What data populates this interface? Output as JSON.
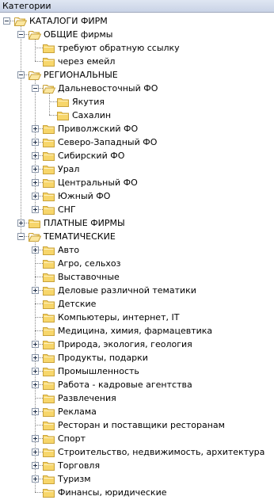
{
  "panel": {
    "title": "Категории"
  },
  "colors": {
    "folder_fill": "#f7d66b",
    "folder_edge": "#c9a23a",
    "header_bg": "#d4dcec"
  },
  "tree": [
    {
      "label": "КАТАЛОГИ ФИРМ",
      "depth": 0,
      "state": "expanded",
      "icon": "folder-open-icon"
    },
    {
      "label": "ОБЩИЕ фирмы",
      "depth": 1,
      "state": "expanded",
      "icon": "folder-open-icon"
    },
    {
      "label": "требуют обратную ссылку",
      "depth": 2,
      "state": "leaf",
      "icon": "folder-icon"
    },
    {
      "label": "через емейл",
      "depth": 2,
      "state": "leaf",
      "icon": "folder-icon"
    },
    {
      "label": "РЕГИОНАЛЬНЫЕ",
      "depth": 1,
      "state": "expanded",
      "icon": "folder-open-icon"
    },
    {
      "label": "Дальневосточный ФО",
      "depth": 2,
      "state": "expanded",
      "icon": "folder-open-icon"
    },
    {
      "label": "Якутия",
      "depth": 3,
      "state": "leaf",
      "icon": "folder-icon"
    },
    {
      "label": "Сахалин",
      "depth": 3,
      "state": "leaf",
      "icon": "folder-icon"
    },
    {
      "label": "Приволжский ФО",
      "depth": 2,
      "state": "collapsed",
      "icon": "folder-icon"
    },
    {
      "label": "Северо-Западный ФО",
      "depth": 2,
      "state": "collapsed",
      "icon": "folder-icon"
    },
    {
      "label": "Сибирский ФО",
      "depth": 2,
      "state": "collapsed",
      "icon": "folder-icon"
    },
    {
      "label": "Урал",
      "depth": 2,
      "state": "collapsed",
      "icon": "folder-icon"
    },
    {
      "label": "Центральный ФО",
      "depth": 2,
      "state": "collapsed",
      "icon": "folder-icon"
    },
    {
      "label": "Южный ФО",
      "depth": 2,
      "state": "collapsed",
      "icon": "folder-icon"
    },
    {
      "label": "СНГ",
      "depth": 2,
      "state": "collapsed",
      "icon": "folder-icon"
    },
    {
      "label": "ПЛАТНЫЕ ФИРМЫ",
      "depth": 1,
      "state": "collapsed",
      "icon": "folder-icon"
    },
    {
      "label": "ТЕМАТИЧЕСКИЕ",
      "depth": 1,
      "state": "expanded",
      "icon": "folder-open-icon"
    },
    {
      "label": "Авто",
      "depth": 2,
      "state": "collapsed",
      "icon": "folder-icon"
    },
    {
      "label": "Агро, сельхоз",
      "depth": 2,
      "state": "leaf",
      "icon": "folder-icon"
    },
    {
      "label": "Выставочные",
      "depth": 2,
      "state": "leaf",
      "icon": "folder-icon"
    },
    {
      "label": "Деловые различной тематики",
      "depth": 2,
      "state": "collapsed",
      "icon": "folder-icon"
    },
    {
      "label": "Детские",
      "depth": 2,
      "state": "leaf",
      "icon": "folder-icon"
    },
    {
      "label": "Компьютеры, интернет, IT",
      "depth": 2,
      "state": "leaf",
      "icon": "folder-icon"
    },
    {
      "label": "Медицина, химия, фармацевтика",
      "depth": 2,
      "state": "leaf",
      "icon": "folder-icon"
    },
    {
      "label": "Природа, экология, геология",
      "depth": 2,
      "state": "collapsed",
      "icon": "folder-icon"
    },
    {
      "label": "Продукты, подарки",
      "depth": 2,
      "state": "collapsed",
      "icon": "folder-icon"
    },
    {
      "label": "Промышленность",
      "depth": 2,
      "state": "collapsed",
      "icon": "folder-icon"
    },
    {
      "label": "Работа - кадровые агентства",
      "depth": 2,
      "state": "collapsed",
      "icon": "folder-icon"
    },
    {
      "label": "Развлечения",
      "depth": 2,
      "state": "leaf",
      "icon": "folder-icon"
    },
    {
      "label": "Реклама",
      "depth": 2,
      "state": "collapsed",
      "icon": "folder-icon"
    },
    {
      "label": "Ресторан и поставщики ресторанам",
      "depth": 2,
      "state": "leaf",
      "icon": "folder-icon"
    },
    {
      "label": "Спорт",
      "depth": 2,
      "state": "collapsed",
      "icon": "folder-icon"
    },
    {
      "label": "Строительство, недвижимость, архитектура",
      "depth": 2,
      "state": "collapsed",
      "icon": "folder-icon"
    },
    {
      "label": "Торговля",
      "depth": 2,
      "state": "collapsed",
      "icon": "folder-icon"
    },
    {
      "label": "Туризм",
      "depth": 2,
      "state": "collapsed",
      "icon": "folder-icon"
    },
    {
      "label": "Финансы, юридические",
      "depth": 2,
      "state": "leaf",
      "icon": "folder-icon"
    }
  ]
}
